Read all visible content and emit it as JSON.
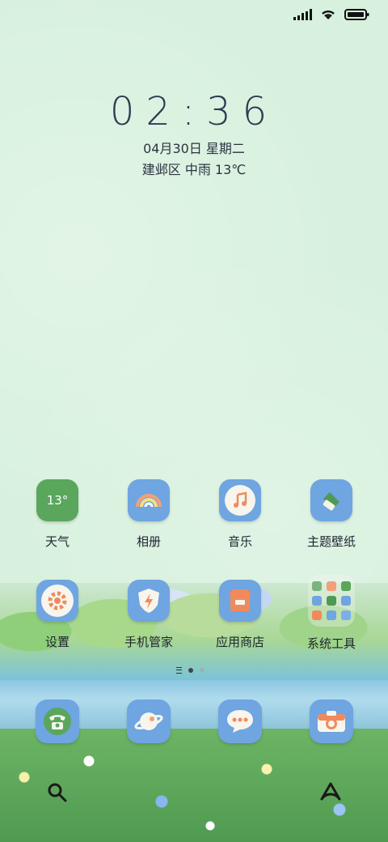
{
  "status": {
    "signal_icon": "cell-signal-icon",
    "wifi_icon": "wifi-icon",
    "battery_icon": "battery-icon"
  },
  "clock": {
    "time": "02:36",
    "date": "04月30日 星期二",
    "weather": "建邺区 中雨 13℃"
  },
  "apps": [
    {
      "label": "天气",
      "icon": "weather-icon",
      "badge": "13°"
    },
    {
      "label": "相册",
      "icon": "rainbow-gallery-icon"
    },
    {
      "label": "音乐",
      "icon": "music-note-icon"
    },
    {
      "label": "主题壁纸",
      "icon": "theme-brush-icon"
    },
    {
      "label": "设置",
      "icon": "gear-icon"
    },
    {
      "label": "手机管家",
      "icon": "shield-bolt-icon"
    },
    {
      "label": "应用商店",
      "icon": "store-icon"
    },
    {
      "label": "系统工具",
      "icon": "folder-grid-icon"
    }
  ],
  "dock": [
    {
      "icon": "phone-icon"
    },
    {
      "icon": "browser-planet-icon"
    },
    {
      "icon": "message-bubble-icon"
    },
    {
      "icon": "camera-icon"
    }
  ],
  "bottom": {
    "search_icon": "search-icon",
    "assistant_icon": "assistant-icon"
  },
  "colors": {
    "background": "#d8f1de",
    "text": "#2f3a52",
    "icon_blue": "#6fa5e0"
  }
}
